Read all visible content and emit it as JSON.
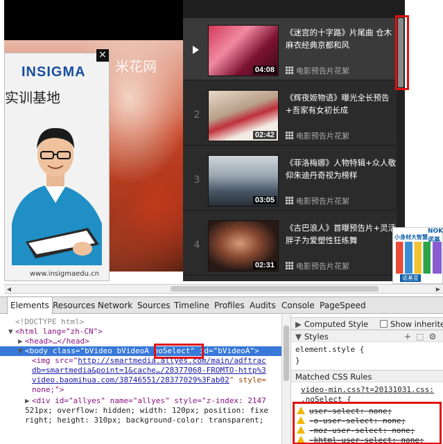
{
  "page": {
    "video": {
      "watermark": "米花网"
    },
    "ad": {
      "logo": "INSIGMA",
      "headline": "实训基地",
      "url": "www.insigmaedu.cn",
      "close_label": "×"
    },
    "playlist": {
      "items": [
        {
          "index": "",
          "title": "《迷宫的十字路》片尾曲 仓木麻衣经典京都和风",
          "duration": "04:08",
          "source": "电影预告片花絮",
          "active": true
        },
        {
          "index": "2",
          "title": "《辉夜姬物语》曝光全长预告+吾家有女初长成",
          "duration": "02:42",
          "source": "电影预告片花絮",
          "active": false
        },
        {
          "index": "3",
          "title": "《菲洛梅娜》人物特辑+众人敬仰朱迪丹奇视为榜样",
          "duration": "03:05",
          "source": "电影预告片花絮",
          "active": false
        },
        {
          "index": "4",
          "title": "《古巴浪人》首曝预告片+灵活胖子为爱塑性狂练舞",
          "duration": "02:31",
          "source": "电影预告片花絮",
          "active": false
        }
      ]
    },
    "side_ad": {
      "t1": "小身材大智慧",
      "t2": "NOKIA 诺基",
      "t3": "诺基亚"
    }
  },
  "colors": {
    "highlight": "#e01010",
    "selection": "#3879d9"
  },
  "devtools": {
    "tabs": [
      "Elements",
      "Resources",
      "Network",
      "Sources",
      "Timeline",
      "Profiles",
      "Audits",
      "Console",
      "PageSpeed"
    ],
    "active_tab": "Elements",
    "dom": {
      "l1": "<!DOCTYPE html>",
      "l2_open": "<html lang=\"zh-CN\">",
      "l3": "<head>…</head>",
      "body_open": "<body",
      "body_class_attr": "class=",
      "body_class_val_a": "\"bVideo bVideoA",
      "body_class_val_b": "noSelect",
      "body_class_val_c": "\"",
      "body_id": "id=\"bVideoA\">",
      "img_open": "<img src=\"",
      "img_src_1": "http://smartmedia.allyes.com/main/adftrac",
      "img_src_2": "db=smartmedia&point=1&cache…/28377068-FROMTO-http%3",
      "img_src_3": "video.baomihua.com/38746551/28377029%3Fab02",
      "img_style": "\" style=",
      "img_tail": "none;\">",
      "div_line1": "<div id=\"allyes\" name=\"allyes\" style=\"z-index: 2147",
      "div_line2": "521px; overflow: hidden; width: 120px; position: fixe",
      "div_line3": "right; height: 310px; background-color: transparent;"
    },
    "styles": {
      "computed_label": "Computed Style",
      "show_inherited": "Show inherite",
      "styles_label": "Styles",
      "element_style": "element.style {",
      "close_brace": "}",
      "matched_label": "Matched CSS Rules",
      "source_link": "video-min.css?t=20131031.css:",
      "selector": ".noSelect {",
      "rules": [
        "user-select: none;",
        "-o-user-select: none;",
        "-moz-user-select: none;",
        "-khtml-user-select: none;"
      ]
    }
  }
}
